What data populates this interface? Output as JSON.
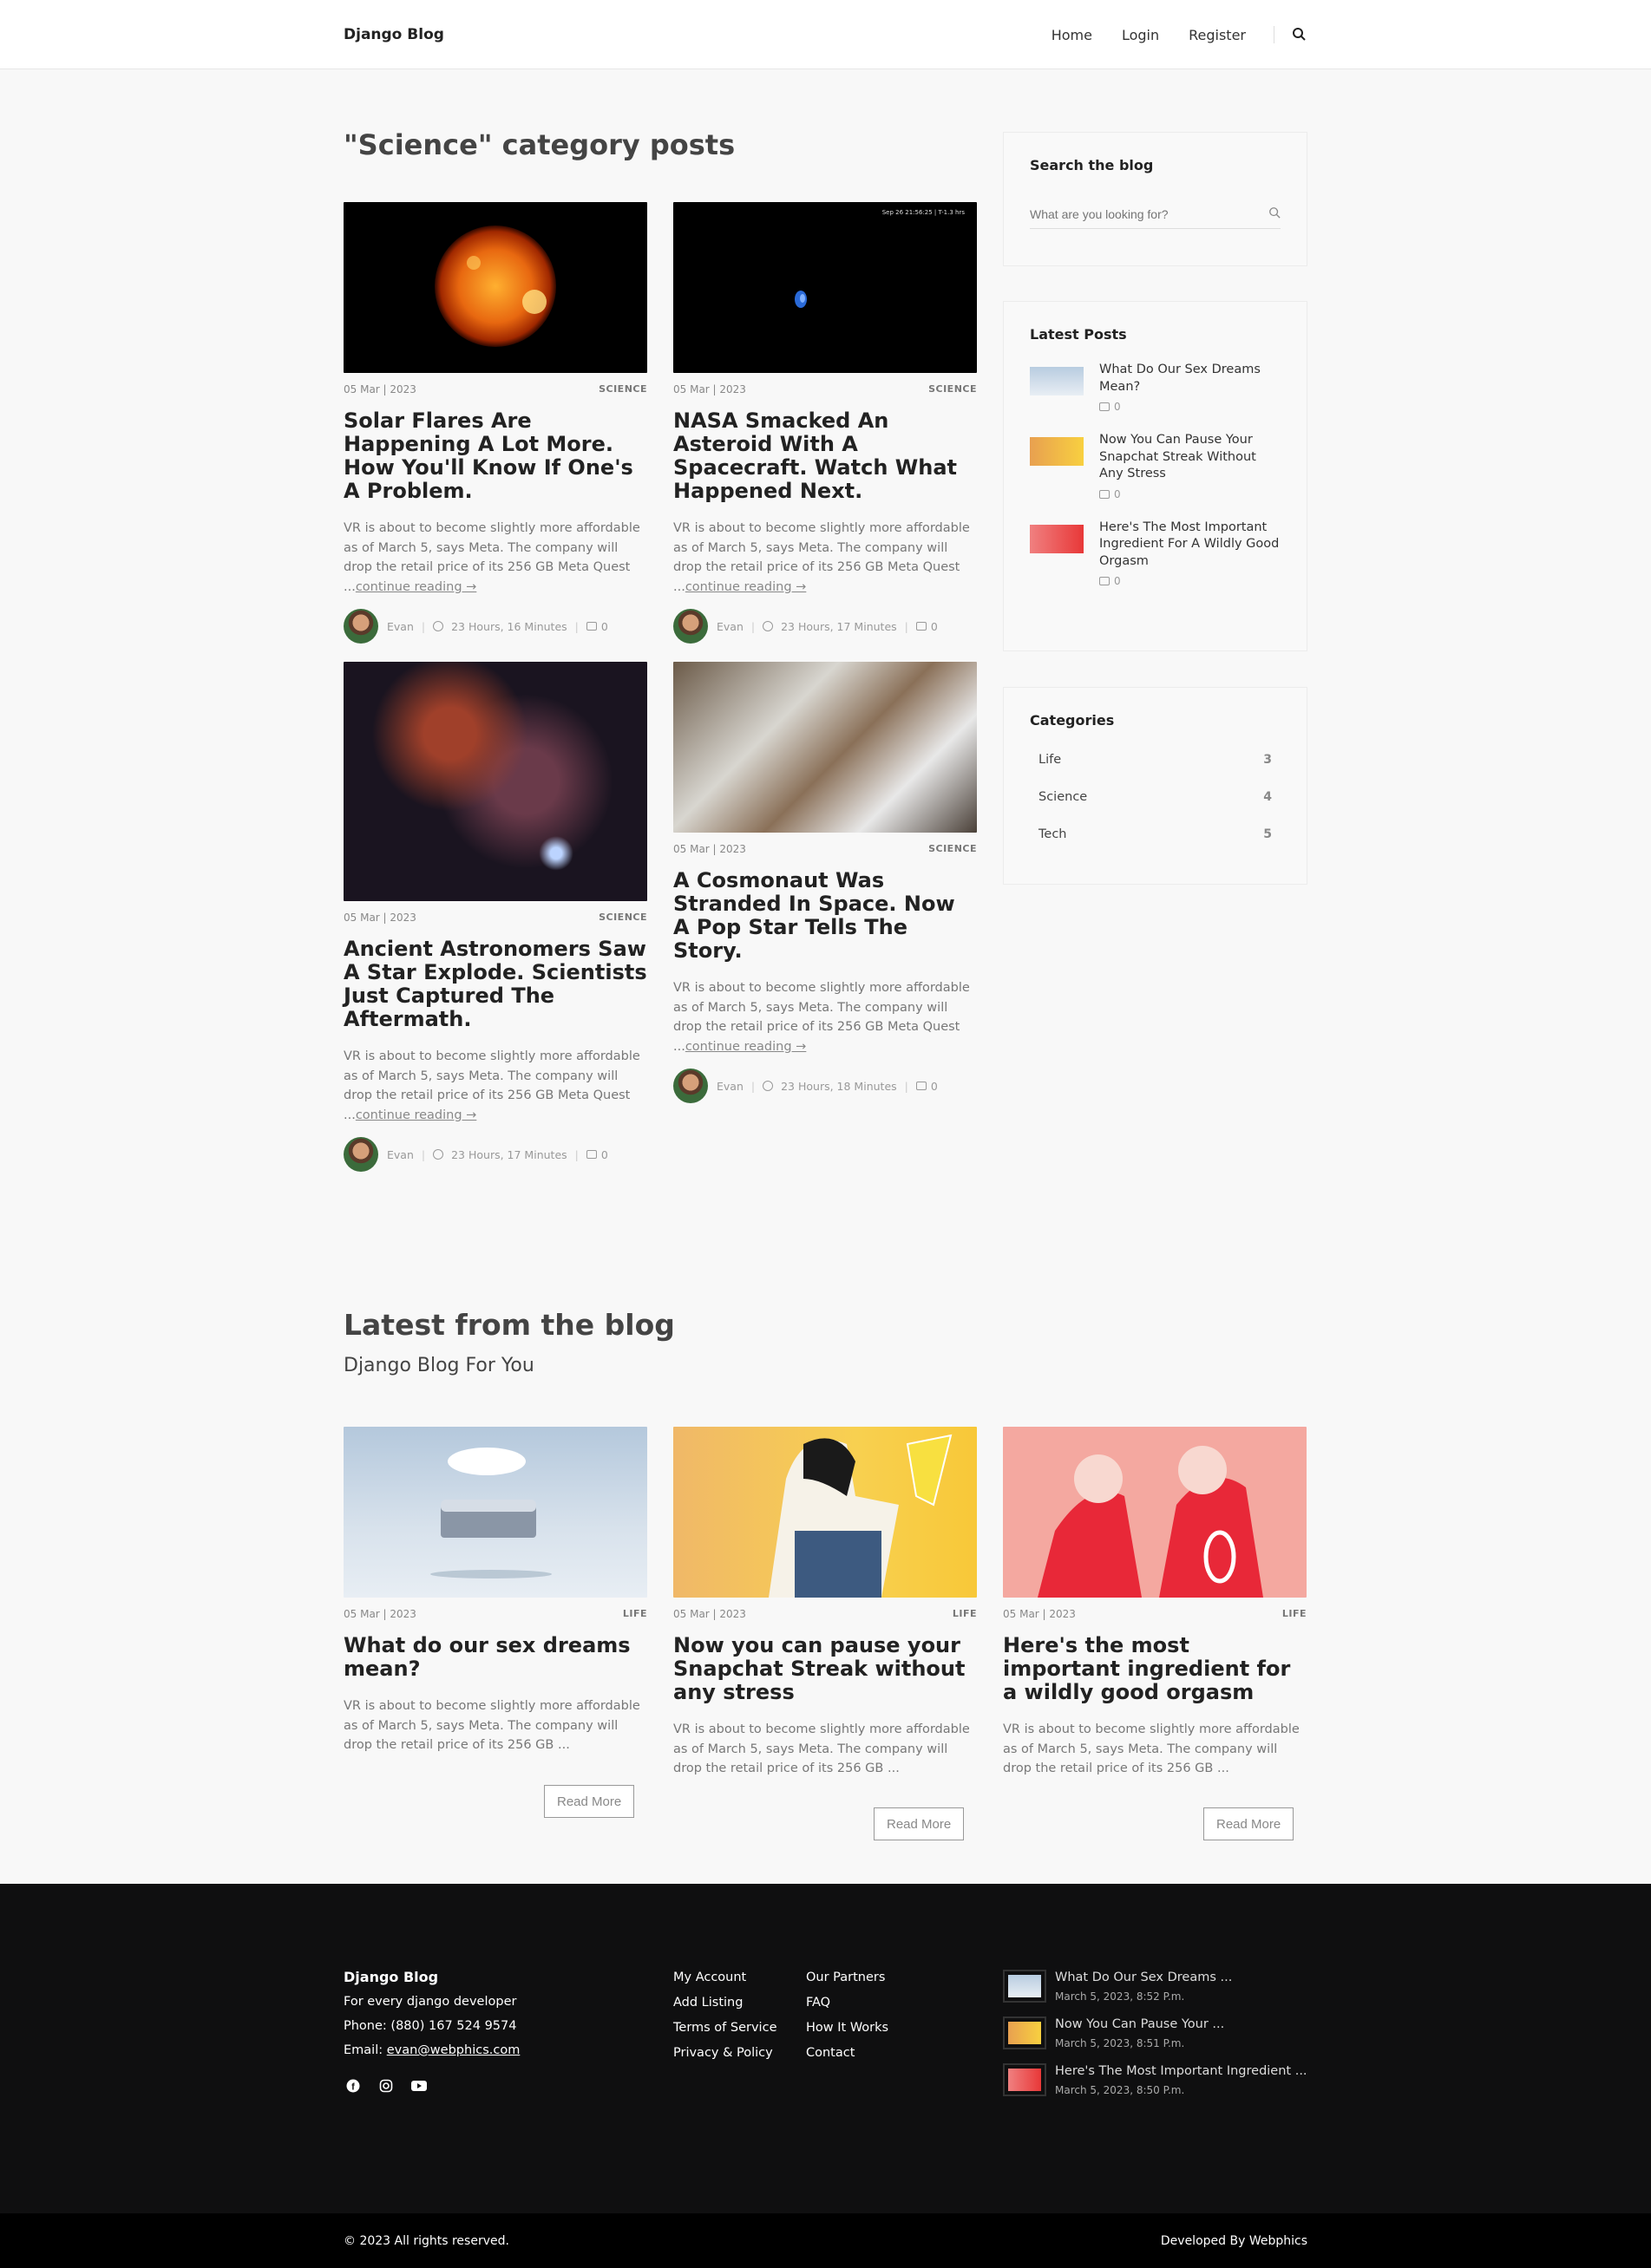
{
  "header": {
    "brand": "Django Blog",
    "nav": [
      "Home",
      "Login",
      "Register"
    ]
  },
  "category_page": {
    "title": "\"Science\" category posts",
    "posts": [
      {
        "date": "05 Mar | 2023",
        "category": "SCIENCE",
        "title": "Solar Flares Are Happening A Lot More. How You'll Know If One's A Problem.",
        "excerpt": "VR is about to become slightly more affordable as of March 5, says Meta. The company will drop the retail price of its 256 GB Meta Quest ...",
        "continue": "continue reading →",
        "author": "Evan",
        "time": "23 Hours, 16 Minutes",
        "comments": "0"
      },
      {
        "date": "05 Mar | 2023",
        "category": "SCIENCE",
        "title": "NASA Smacked An Asteroid With A Spacecraft. Watch What Happened Next.",
        "excerpt": "VR is about to become slightly more affordable as of March 5, says Meta. The company will drop the retail price of its 256 GB Meta Quest ...",
        "continue": "continue reading →",
        "author": "Evan",
        "time": "23 Hours, 17 Minutes",
        "comments": "0",
        "img_caption": "Sep 26 21:56:25 | T-1.3 hrs"
      },
      {
        "date": "05 Mar | 2023",
        "category": "SCIENCE",
        "title": "Ancient Astronomers Saw A Star Explode. Scientists Just Captured The Aftermath.",
        "excerpt": "VR is about to become slightly more affordable as of March 5, says Meta. The company will drop the retail price of its 256 GB Meta Quest ...",
        "continue": "continue reading →",
        "author": "Evan",
        "time": "23 Hours, 17 Minutes",
        "comments": "0"
      },
      {
        "date": "05 Mar | 2023",
        "category": "SCIENCE",
        "title": "A Cosmonaut Was Stranded In Space. Now A Pop Star Tells The Story.",
        "excerpt": "VR is about to become slightly more affordable as of March 5, says Meta. The company will drop the retail price of its 256 GB Meta Quest ...",
        "continue": "continue reading →",
        "author": "Evan",
        "time": "23 Hours, 18 Minutes",
        "comments": "0"
      }
    ]
  },
  "sidebar": {
    "search_title": "Search the blog",
    "search_placeholder": "What are you looking for?",
    "latest_title": "Latest Posts",
    "latest": [
      {
        "title": "What Do Our Sex Dreams Mean?",
        "comments": "0"
      },
      {
        "title": "Now You Can Pause Your Snapchat Streak Without Any Stress",
        "comments": "0"
      },
      {
        "title": "Here's The Most Important Ingredient For A Wildly Good Orgasm",
        "comments": "0"
      }
    ],
    "categories_title": "Categories",
    "categories": [
      {
        "name": "Life",
        "count": "3"
      },
      {
        "name": "Science",
        "count": "4"
      },
      {
        "name": "Tech",
        "count": "5"
      }
    ]
  },
  "latest_blog": {
    "title": "Latest from the blog",
    "subtitle": "Django Blog For You",
    "read_more": "Read More",
    "posts": [
      {
        "date": "05 Mar | 2023",
        "category": "LIFE",
        "title": "What do our sex dreams mean?",
        "excerpt": "VR is about to become slightly more affordable as of March 5, says Meta. The company will drop the retail price of its 256 GB ..."
      },
      {
        "date": "05 Mar | 2023",
        "category": "LIFE",
        "title": "Now you can pause your Snapchat Streak without any stress",
        "excerpt": "VR is about to become slightly more affordable as of March 5, says Meta. The company will drop the retail price of its 256 GB ..."
      },
      {
        "date": "05 Mar | 2023",
        "category": "LIFE",
        "title": "Here's the most important ingredient for a wildly good orgasm",
        "excerpt": "VR is about to become slightly more affordable as of March 5, says Meta. The company will drop the retail price of its 256 GB ..."
      }
    ]
  },
  "footer": {
    "brand": "Django Blog",
    "tagline": "For every django developer",
    "phone": "Phone: (880) 167 524 9574",
    "email_label": "Email: ",
    "email": "evan@webphics.com",
    "col1": [
      "My Account",
      "Add Listing",
      "Terms of Service",
      "Privacy & Policy"
    ],
    "col2": [
      "Our Partners",
      "FAQ",
      "How It Works",
      "Contact"
    ],
    "recent": [
      {
        "title": "What Do Our Sex Dreams ...",
        "date": "March 5, 2023, 8:52 P.m."
      },
      {
        "title": "Now You Can Pause Your ...",
        "date": "March 5, 2023, 8:51 P.m."
      },
      {
        "title": "Here's The Most Important Ingredient ...",
        "date": "March 5, 2023, 8:50 P.m."
      }
    ],
    "copyright": "© 2023 All rights reserved.",
    "developed_by": "Developed By ",
    "developer": "Webphics"
  }
}
